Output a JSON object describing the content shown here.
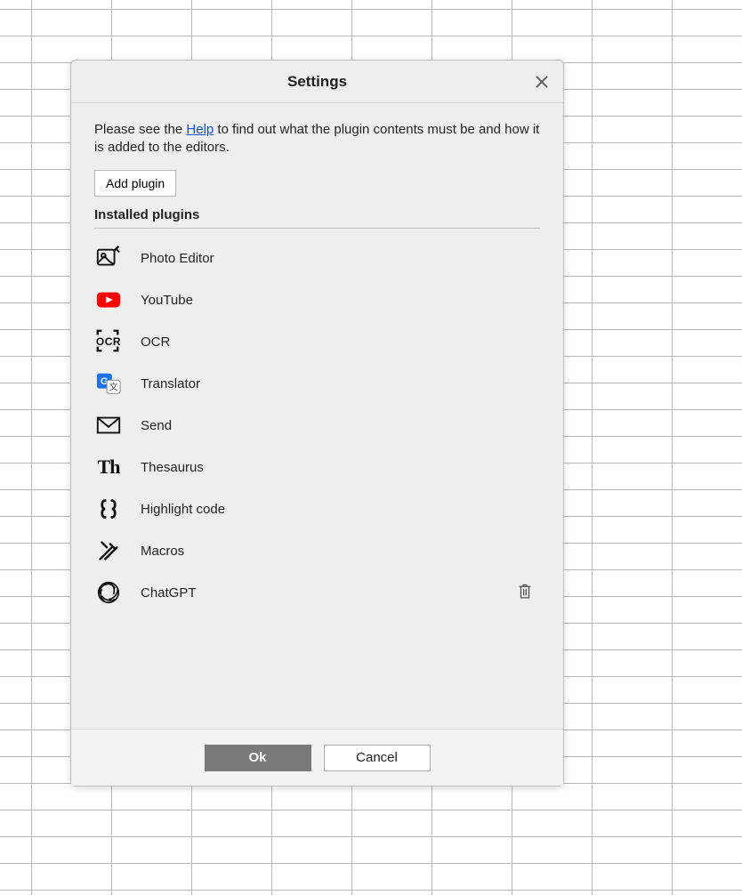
{
  "dialog": {
    "title": "Settings",
    "help_prefix": "Please see the ",
    "help_link_text": "Help",
    "help_suffix": " to find out what the plugin contents must be and how it is added to the editors.",
    "add_plugin_label": "Add plugin",
    "installed_heading": "Installed plugins",
    "plugins": [
      {
        "name": "Photo Editor",
        "icon": "photo-editor"
      },
      {
        "name": "YouTube",
        "icon": "youtube"
      },
      {
        "name": "OCR",
        "icon": "ocr"
      },
      {
        "name": "Translator",
        "icon": "translator"
      },
      {
        "name": "Send",
        "icon": "send"
      },
      {
        "name": "Thesaurus",
        "icon": "thesaurus"
      },
      {
        "name": "Highlight code",
        "icon": "highlight-code"
      },
      {
        "name": "Macros",
        "icon": "macros"
      },
      {
        "name": "ChatGPT",
        "icon": "chatgpt",
        "deletable": true
      }
    ],
    "ok_label": "Ok",
    "cancel_label": "Cancel"
  }
}
